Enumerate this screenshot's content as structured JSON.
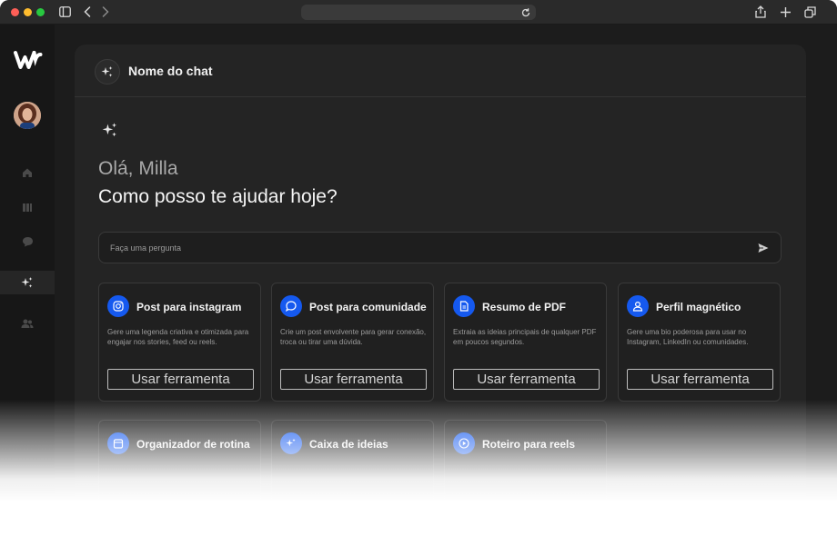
{
  "header": {
    "title": "Nome do chat"
  },
  "greeting": {
    "hello": "Olá, Milla",
    "question": "Como posso te ajudar hoje?"
  },
  "search": {
    "placeholder": "Faça uma pergunta"
  },
  "cards": [
    {
      "title": "Post para instagram",
      "desc": "Gere uma legenda criativa e otimizada para engajar nos stories, feed ou reels.",
      "button": "Usar ferramenta",
      "icon": "instagram-icon"
    },
    {
      "title": "Post para comunidade",
      "desc": "Crie um post envolvente para gerar conexão, troca ou tirar uma dúvida.",
      "button": "Usar ferramenta",
      "icon": "chat-bubble-icon"
    },
    {
      "title": "Resumo de PDF",
      "desc": "Extraia as ideias principais de qualquer PDF em poucos segundos.",
      "button": "Usar ferramenta",
      "icon": "document-icon"
    },
    {
      "title": "Perfil magnético",
      "desc": "Gere uma bio poderosa para usar no Instagram, LinkedIn ou comunidades.",
      "button": "Usar ferramenta",
      "icon": "user-icon"
    },
    {
      "title": "Organizador de rotina",
      "desc": "",
      "button": "",
      "icon": "calendar-icon"
    },
    {
      "title": "Caixa de ideias",
      "desc": "",
      "button": "",
      "icon": "sparkles-icon"
    },
    {
      "title": "Roteiro para reels",
      "desc": "",
      "button": "",
      "icon": "play-icon"
    }
  ],
  "colors": {
    "accent": "#1559ef",
    "background": "#1c1c1c",
    "panel": "#242424"
  }
}
